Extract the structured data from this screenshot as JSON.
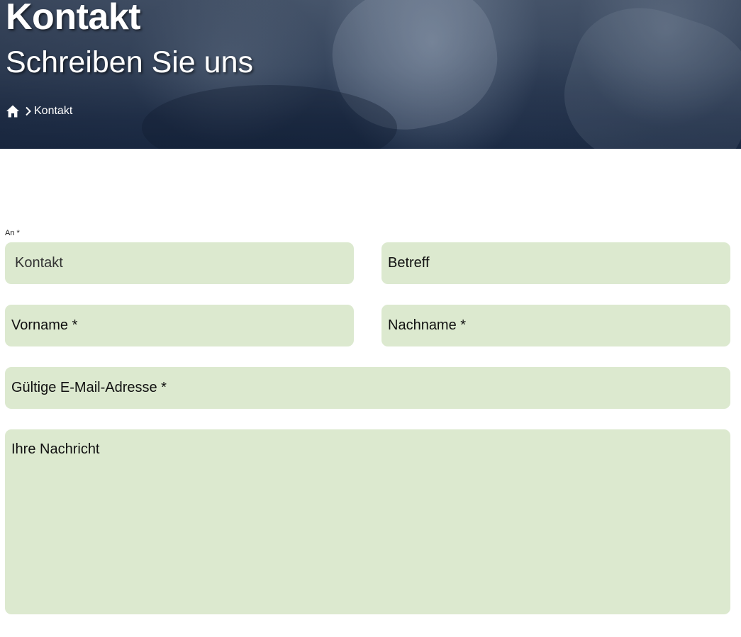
{
  "hero": {
    "title": "Kontakt",
    "subtitle": "Schreiben Sie uns",
    "breadcrumb": {
      "home_icon": "home-icon",
      "separator_icon": "chevron-right-icon",
      "current": "Kontakt"
    }
  },
  "form": {
    "recipient_label": "An *",
    "recipient_value": "Kontakt",
    "subject_placeholder": "Betreff",
    "first_name_placeholder": "Vorname *",
    "last_name_placeholder": "Nachname *",
    "email_placeholder": "Gültige E-Mail-Adresse *",
    "message_placeholder": "Ihre Nachricht"
  },
  "colors": {
    "field_background": "#dce9cf",
    "hero_overlay": "#1a2a44",
    "text": "#111111"
  }
}
